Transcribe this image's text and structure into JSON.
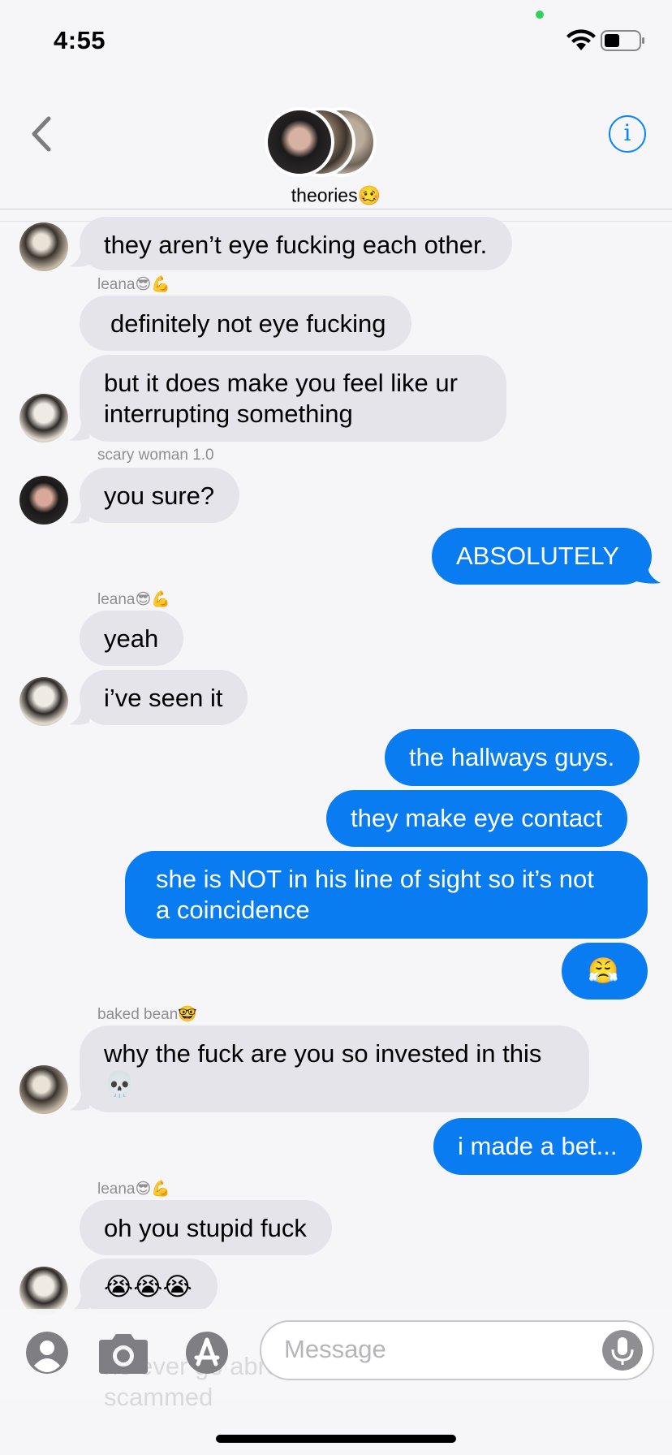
{
  "status_bar": {
    "time": "4:55"
  },
  "header": {
    "group_name": "theories",
    "group_emoji": "🥴",
    "info_label": "i"
  },
  "messages": [
    {
      "type": "in",
      "text": "they aren’t eye fucking each other."
    },
    {
      "type": "sender",
      "text": "leana😎💪"
    },
    {
      "type": "in",
      "text": "definitely not eye fucking"
    },
    {
      "type": "in",
      "line1": "but it does make you feel like ur",
      "line2": "interrupting something"
    },
    {
      "type": "sender",
      "text": "scary woman 1.0"
    },
    {
      "type": "in",
      "text": "you sure?"
    },
    {
      "type": "out",
      "text": "ABSOLUTELY"
    },
    {
      "type": "sender",
      "text": "leana😎💪"
    },
    {
      "type": "in",
      "text": "yeah"
    },
    {
      "type": "in",
      "text": "i’ve seen it"
    },
    {
      "type": "out",
      "text": "the hallways guys."
    },
    {
      "type": "out",
      "text": "they make eye contact"
    },
    {
      "type": "out",
      "line1": "she is NOT in his line of sight so it’s not",
      "line2": "a coincidence"
    },
    {
      "type": "out",
      "text": "😤"
    },
    {
      "type": "sender",
      "text": "baked bean🤓"
    },
    {
      "type": "in",
      "line1": "why the fuck are you so invested in this",
      "line2": "💀"
    },
    {
      "type": "out",
      "text": "i made a bet..."
    },
    {
      "type": "sender",
      "text": "leana😎💪"
    },
    {
      "type": "in",
      "text": "oh you stupid fuck"
    },
    {
      "type": "in",
      "text": "😭😭😭"
    }
  ],
  "input_bar": {
    "placeholder": "Message",
    "ghost_line1": "he ever go abroad and gets",
    "ghost_line2": "scammed"
  },
  "colors": {
    "outgoing": "#0a7cf1",
    "incoming": "#e5e4ea",
    "accent": "#0a84ff"
  },
  "icons": [
    "back-chevron-icon",
    "info-icon",
    "wifi-icon",
    "battery-icon",
    "contact-icon",
    "camera-icon",
    "app-store-icon",
    "microphone-icon"
  ]
}
